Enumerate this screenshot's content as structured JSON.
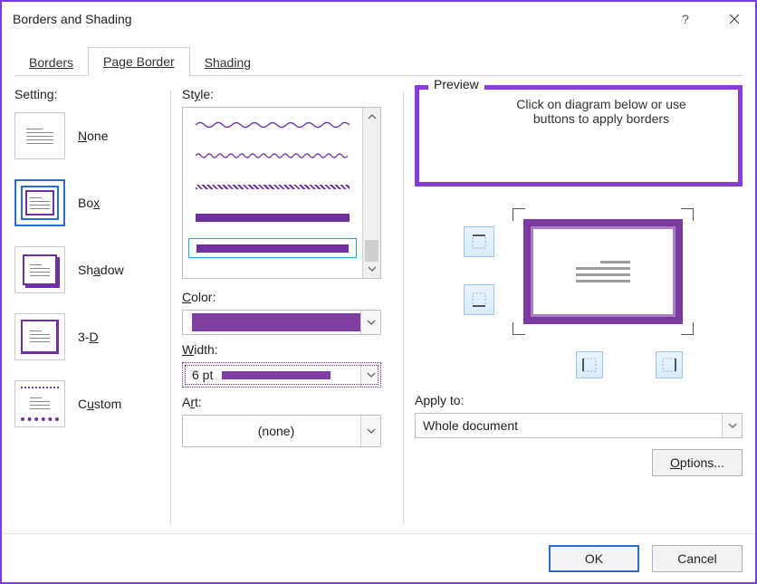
{
  "title": "Borders and Shading",
  "tabs": {
    "borders": "Borders",
    "page_border": "Page Border",
    "shading": "Shading"
  },
  "settings": {
    "label": "Setting:",
    "items": {
      "none": "None",
      "box": "Box",
      "shadow": "Shadow",
      "three_d": "3-D",
      "custom": "Custom"
    }
  },
  "style": {
    "label": "Style:",
    "color_label": "Color:",
    "color_value": "#7e3fa0",
    "width_label": "Width:",
    "width_value": "6 pt",
    "art_label": "Art:",
    "art_value": "(none)"
  },
  "preview": {
    "label": "Preview",
    "hint": "Click on diagram below or use buttons to apply borders",
    "apply_to_label": "Apply to:",
    "apply_to_value": "Whole document",
    "options": "Options..."
  },
  "footer": {
    "ok": "OK",
    "cancel": "Cancel"
  }
}
